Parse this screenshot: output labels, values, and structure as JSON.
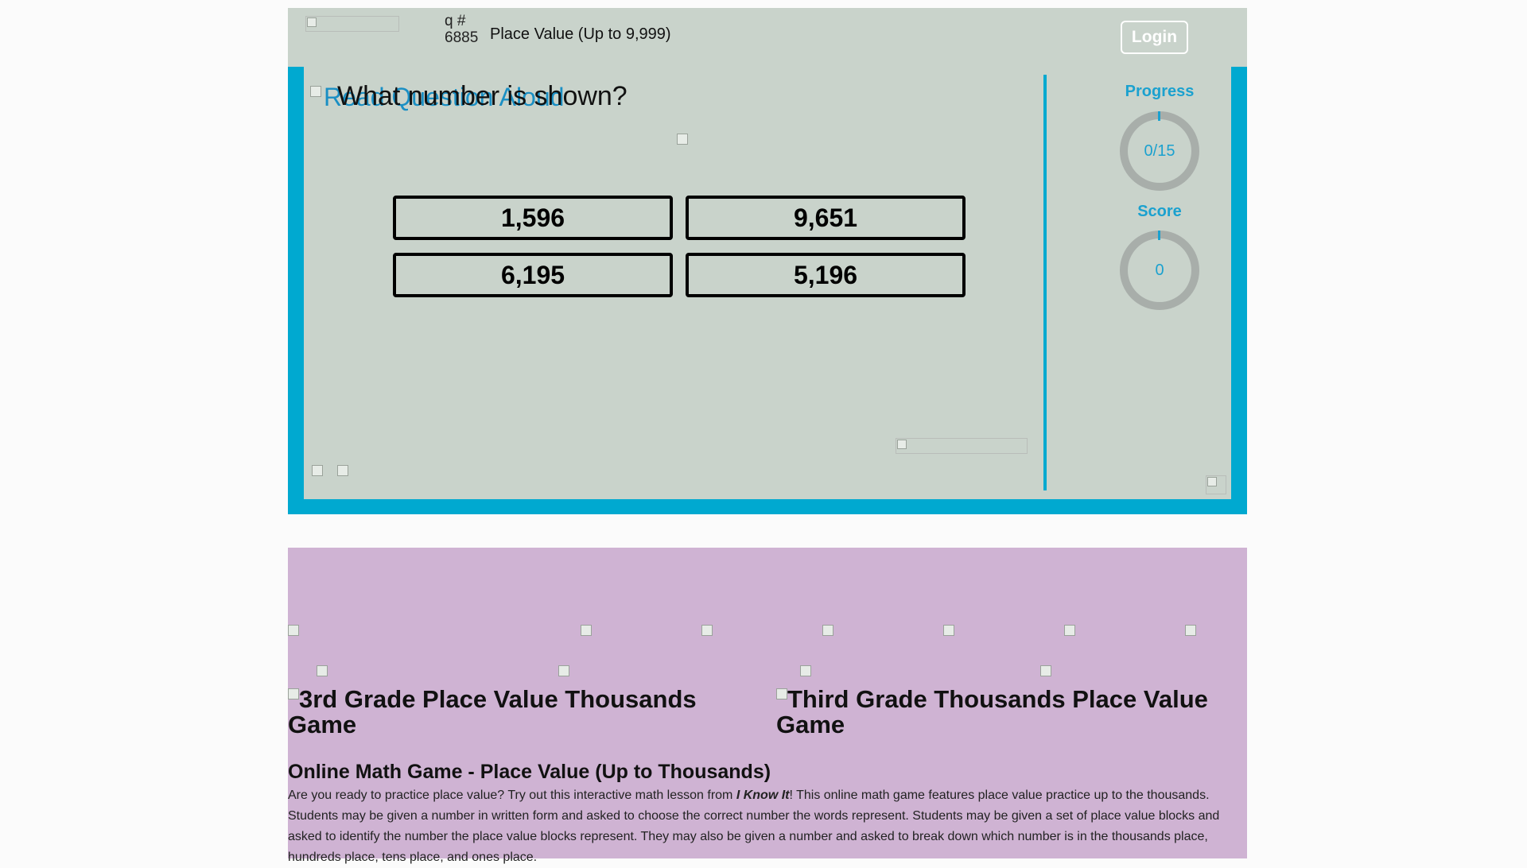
{
  "header": {
    "question_number": "q # 6885",
    "lesson_title": "Place Value (Up to 9,999)",
    "login_label": "Login"
  },
  "question": {
    "read_aloud_label": "Read Question Aloud",
    "text": "What number is shown?",
    "answers": [
      "1,596",
      "9,651",
      "6,195",
      "5,196"
    ]
  },
  "stats": {
    "progress_label": "Progress",
    "progress_value": "0/15",
    "score_label": "Score",
    "score_value": "0"
  },
  "info": {
    "game_captions": [
      "3rd Grade Place Value Thousands Game",
      "Third Grade Thousands Place Value Game"
    ],
    "heading": "Online Math Game - Place Value (Up to Thousands)",
    "text_before": "Are you ready to practice place value? Try out this interactive math lesson from ",
    "brand": "I Know It",
    "text_after": "! This online math game features place value practice up to the thousands. Students may be given a number in written form and asked to choose the correct number the words represent. Students may be given a set of place value blocks and asked to identify the number the place value blocks represent. They may also be given a number and asked to break down which number is in the thousands place, hundreds place, tens place, and ones place."
  },
  "colors": {
    "frame_blue": "#00a9d0",
    "panel_gray": "#c9d3cb",
    "info_purple": "#cfb3d3",
    "accent_text": "#1ba1cf"
  }
}
